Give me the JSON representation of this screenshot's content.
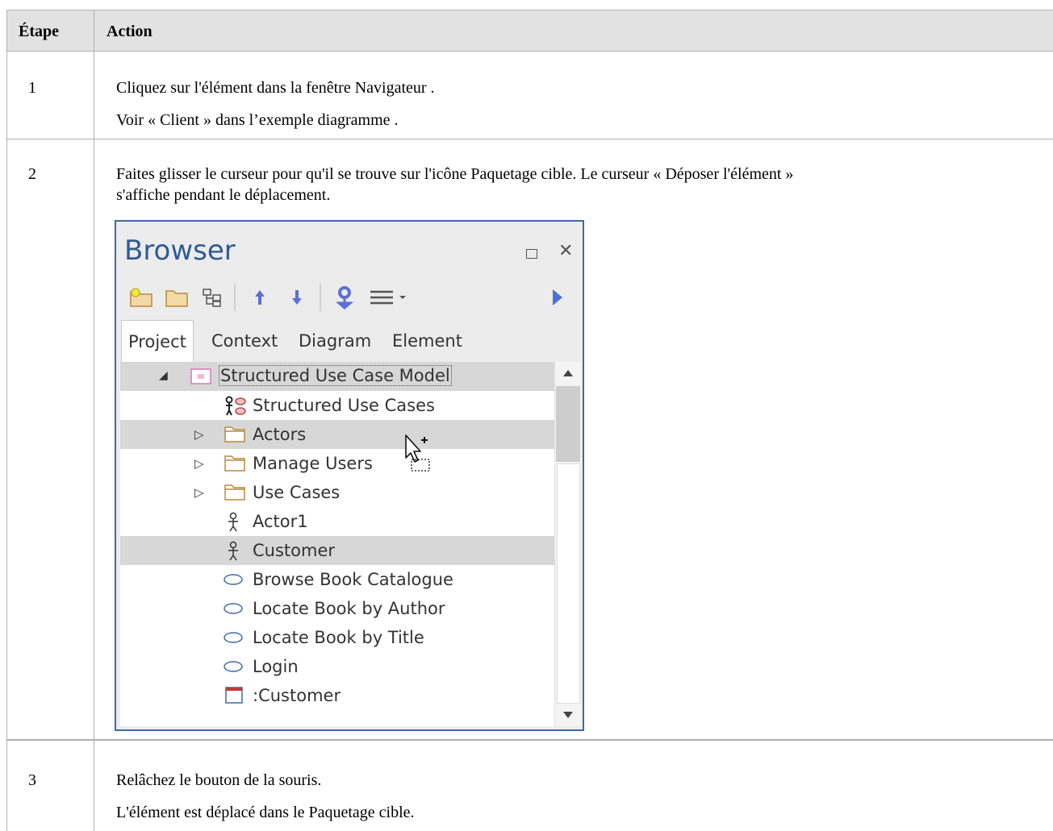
{
  "table": {
    "header": {
      "step": "Étape",
      "action": "Action"
    },
    "rows": [
      {
        "step": "1",
        "lines": [
          "Cliquez sur l'élément dans la fenêtre Navigateur .",
          "Voir « Client » dans l’exemple diagramme ."
        ]
      },
      {
        "step": "2",
        "lines": [
          "Faites glisser le curseur pour qu'il se trouve sur l'icône Paquetage cible. Le curseur « Déposer l'élément »",
          "s'affiche pendant le déplacement."
        ]
      },
      {
        "step": "3",
        "lines": [
          "Relâchez le bouton de la souris.",
          "L'élément est déplacé dans le Paquetage cible."
        ]
      }
    ]
  },
  "browser": {
    "title": "Browser",
    "accent_color": "#3e6aa7",
    "toolbar_icons": [
      "new-package-icon",
      "folder-icon",
      "hierarchy-icon",
      "arrow-up-icon",
      "arrow-down-icon",
      "locate-icon",
      "menu-icon",
      "play-icon"
    ],
    "tabs": [
      "Project",
      "Context",
      "Diagram",
      "Element"
    ],
    "active_tab": "Project",
    "tree": [
      {
        "label": "Structured Use Case Model",
        "icon": "model-package-icon",
        "expander": "expanded",
        "selected": true
      },
      {
        "label": "Structured Use Cases",
        "icon": "usecase-diagram-icon",
        "expander": "none",
        "selected": false
      },
      {
        "label": "Actors",
        "icon": "folder-icon",
        "expander": "collapsed",
        "selected": true
      },
      {
        "label": "Manage Users",
        "icon": "folder-icon",
        "expander": "collapsed",
        "selected": false
      },
      {
        "label": "Use Cases",
        "icon": "folder-icon",
        "expander": "collapsed",
        "selected": false
      },
      {
        "label": "Actor1",
        "icon": "actor-icon",
        "expander": "none",
        "selected": false
      },
      {
        "label": "Customer",
        "icon": "actor-icon",
        "expander": "none",
        "selected": true
      },
      {
        "label": "Browse Book Catalogue",
        "icon": "usecase-icon",
        "expander": "none",
        "selected": false
      },
      {
        "label": "Locate Book by Author",
        "icon": "usecase-icon",
        "expander": "none",
        "selected": false
      },
      {
        "label": "Locate Book by Title",
        "icon": "usecase-icon",
        "expander": "none",
        "selected": false
      },
      {
        "label": "Login",
        "icon": "usecase-icon",
        "expander": "none",
        "selected": false
      },
      {
        "label": ":Customer",
        "icon": "object-instance-icon",
        "expander": "none",
        "selected": false
      }
    ]
  }
}
